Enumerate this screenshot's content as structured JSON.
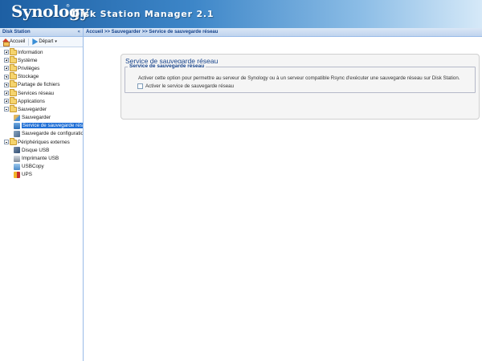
{
  "header": {
    "logo_text": "Synology",
    "logo_mark": "®",
    "app_title": "Disk Station Manager 2.1"
  },
  "sidebar": {
    "title": "Disk Station",
    "collapse_glyph": "«",
    "toolbar": {
      "home_label": "Accueil",
      "depart_label": "Départ",
      "depart_caret": "▾"
    },
    "tree": [
      {
        "label": "Information",
        "level": 1,
        "expanded": false,
        "icon": "folder-icon"
      },
      {
        "label": "Système",
        "level": 1,
        "expanded": false,
        "icon": "folder-icon"
      },
      {
        "label": "Privilèges",
        "level": 1,
        "expanded": false,
        "icon": "folder-icon"
      },
      {
        "label": "Stockage",
        "level": 1,
        "expanded": false,
        "icon": "folder-icon"
      },
      {
        "label": "Partage de fichiers",
        "level": 1,
        "expanded": false,
        "icon": "folder-icon"
      },
      {
        "label": "Services réseau",
        "level": 1,
        "expanded": false,
        "icon": "folder-icon"
      },
      {
        "label": "Applications",
        "level": 1,
        "expanded": false,
        "icon": "folder-icon"
      },
      {
        "label": "Sauvegarder",
        "level": 1,
        "expanded": true,
        "icon": "folder-icon"
      },
      {
        "label": "Sauvegarder",
        "level": 2,
        "icon": "backup-icon"
      },
      {
        "label": "Service de sauvegarde résea",
        "level": 2,
        "icon": "network-backup-icon",
        "selected": true
      },
      {
        "label": "Sauvegarde de configuratio",
        "level": 2,
        "icon": "config-backup-icon"
      },
      {
        "label": "Périphériques externes",
        "level": 1,
        "expanded": true,
        "icon": "folder-icon"
      },
      {
        "label": "Disque USB",
        "level": 2,
        "icon": "usb-disk-icon"
      },
      {
        "label": "Imprimante USB",
        "level": 2,
        "icon": "printer-icon"
      },
      {
        "label": "USBCopy",
        "level": 2,
        "icon": "usbcopy-icon"
      },
      {
        "label": "UPS",
        "level": 2,
        "icon": "ups-icon"
      }
    ]
  },
  "breadcrumb": "Accueil >> Sauvegarder >> Service de sauvegarde réseau",
  "main": {
    "panel_title": "Service de sauvegarde réseau",
    "section_legend": "Service de sauvegarde réseau",
    "description": "Activer cette option pour permettre au serveur de Synology ou à un serveur compatible Rsync d'exécuter une sauvegarde réseau sur Disk Station.",
    "checkbox_label": "Activer le service de sauvegarde réseau",
    "checkbox_checked": false
  },
  "colors": {
    "accent": "#15428b",
    "selection": "#1f6fd6"
  }
}
